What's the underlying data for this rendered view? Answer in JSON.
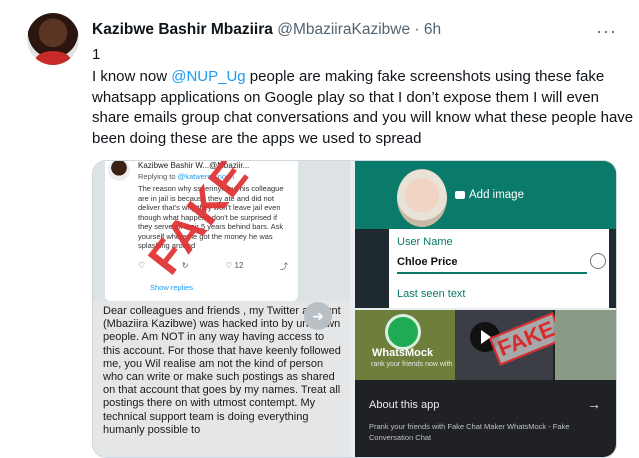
{
  "tweet": {
    "name": "Kazibwe Bashir Mbaziira",
    "handle": "@MbaziiraKazibwe",
    "separator": " · ",
    "time": "6h",
    "more_label": "···",
    "line_number": "1",
    "text_before": "I know now ",
    "mention": "@NUP_Ug",
    "text_after": " people are making fake screenshots using these fake whatsapp applications on Google play so that I don’t expose them I will even share emails group chat conversations and you will know what these people have been doing these are the apps we used to spread"
  },
  "media": {
    "embedded_tweet": {
      "name": "Kazibwe Bashir W...@Mbaziir...",
      "replying_to_prefix": "Replying to ",
      "replying_to": "@katwere...noch",
      "text": "The reason why sseerinyi and his colleague are in jail is because they ate and did not deliver that's why they won't leave jail even though what happens don't be surprised if they serve all their 5 years behind bars. Ask yourself where he got the money he was splashing around",
      "actions": [
        "♡",
        "↻",
        "♡ 12",
        "⤴"
      ],
      "show_replies": "Show replies",
      "stamp": "FAKE"
    },
    "letter": "Dear colleagues and friends , my Twitter account (Mbaziira Kazibwe) was hacked into by unknown people. Am NOT in any way having access to this account. For those that have keenly followed me, you Wil realise am not the kind of person who can write or make such postings as shared on that account that goes by my names. Treat all postings there on with utmost contempt. My technical support team is doing everything humanly possible to",
    "next_arrow": "➜",
    "whatsapp_edit": {
      "add_image": "Add image",
      "user_name_label": "User Name",
      "user_name_value": "Chloe Price",
      "last_seen_label": "Last seen text"
    },
    "store": {
      "app_title": "WhatsMock",
      "tagline": "rank your friends now with",
      "fake_stamp": "FAKE",
      "about_label": "About this app",
      "about_arrow": "→",
      "description": "Prank your friends with Fake Chat Maker WhatsMock - Fake Conversation Chat"
    }
  }
}
